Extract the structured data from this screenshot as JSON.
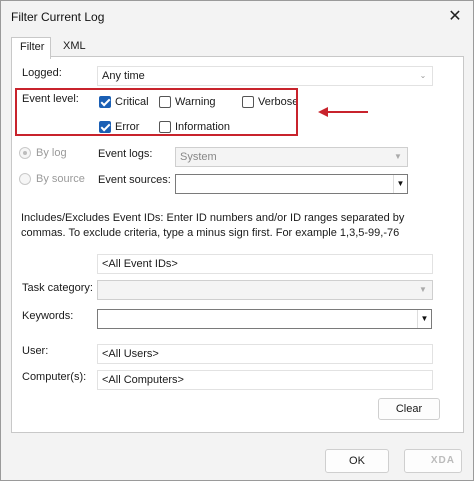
{
  "window": {
    "title": "Filter Current Log"
  },
  "tabs": [
    {
      "label": "Filter"
    },
    {
      "label": "XML"
    }
  ],
  "logged": {
    "label": "Logged:",
    "value": "Any time"
  },
  "event_level": {
    "label": "Event level:",
    "options": [
      {
        "label": "Critical",
        "checked": true
      },
      {
        "label": "Warning",
        "checked": false
      },
      {
        "label": "Verbose",
        "checked": false
      },
      {
        "label": "Error",
        "checked": true
      },
      {
        "label": "Information",
        "checked": false
      }
    ]
  },
  "by_log": {
    "label": "By log",
    "selected": true
  },
  "by_source": {
    "label": "By source",
    "selected": false
  },
  "event_logs": {
    "label": "Event logs:",
    "value": "System"
  },
  "event_sources": {
    "label": "Event sources:",
    "value": ""
  },
  "description": "Includes/Excludes Event IDs: Enter ID numbers and/or ID ranges separated by commas. To exclude criteria, type a minus sign first. For example 1,3,5-99,-76",
  "event_ids": {
    "value": "<All Event IDs>"
  },
  "task_category": {
    "label": "Task category:",
    "value": ""
  },
  "keywords": {
    "label": "Keywords:",
    "value": ""
  },
  "user": {
    "label": "User:",
    "value": "<All Users>"
  },
  "computers": {
    "label": "Computer(s):",
    "value": "<All Computers>"
  },
  "buttons": {
    "clear": "Clear",
    "ok": "OK"
  },
  "annotation": {
    "highlight_color": "#c8232c"
  },
  "colors": {
    "check_accent": "#1a5fb4"
  }
}
